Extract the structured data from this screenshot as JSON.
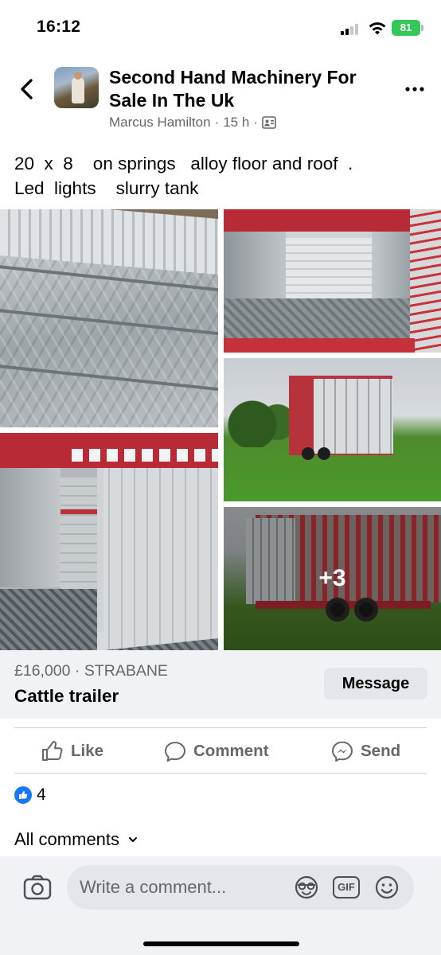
{
  "status_bar": {
    "time": "16:12",
    "battery": "81",
    "battery_color": "#34c759"
  },
  "header": {
    "group_name": "Second Hand Machinery For Sale In The Uk",
    "author": "Marcus Hamilton",
    "time_ago": "15 h",
    "separator": "·",
    "privacy_icon": "group-members-icon",
    "back_icon": "chevron-left-icon",
    "more_icon": "more-dots-icon"
  },
  "post": {
    "text": "20  x  8    on springs   alloy floor and roof  .\nLed  lights    slurry tank"
  },
  "photos": {
    "more_count": "+3"
  },
  "listing": {
    "price_location": "£16,000 · STRABANE",
    "title": "Cattle trailer",
    "message_label": "Message"
  },
  "actions": {
    "like_label": "Like",
    "comment_label": "Comment",
    "send_label": "Send"
  },
  "reactions": {
    "count": "4",
    "accent": "#1877f2"
  },
  "comments": {
    "all_comments_label": "All comments"
  },
  "composer": {
    "placeholder": "Write a comment...",
    "gif_label": "GIF"
  }
}
